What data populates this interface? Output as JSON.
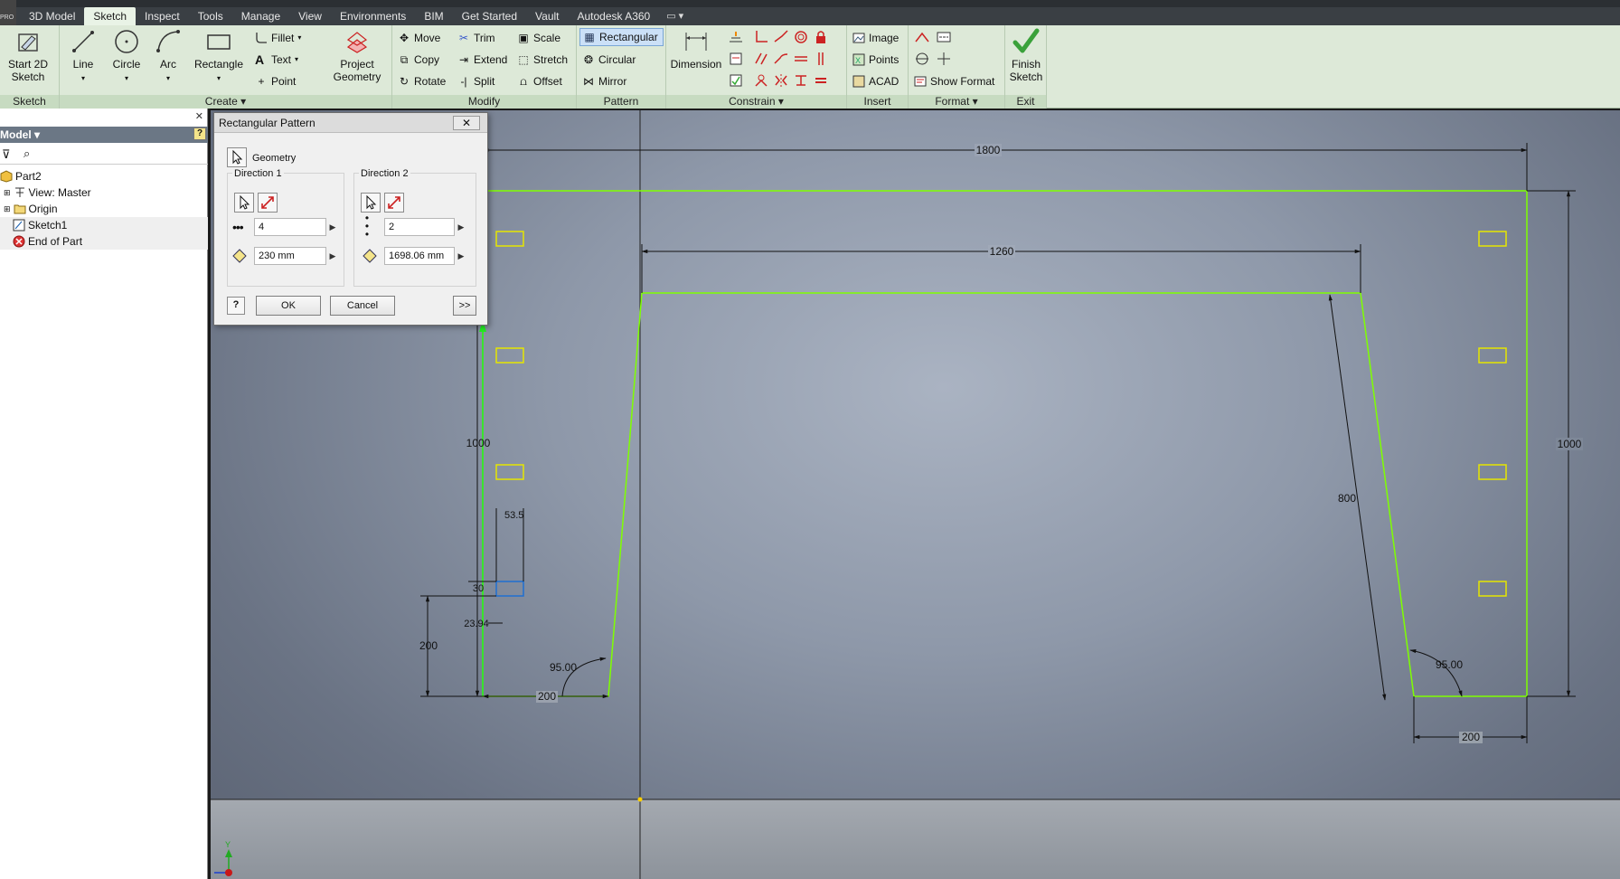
{
  "app": {
    "badge": "PRO"
  },
  "tabs": [
    {
      "label": "3D Model",
      "active": false
    },
    {
      "label": "Sketch",
      "active": true
    },
    {
      "label": "Inspect",
      "active": false
    },
    {
      "label": "Tools",
      "active": false
    },
    {
      "label": "Manage",
      "active": false
    },
    {
      "label": "View",
      "active": false
    },
    {
      "label": "Environments",
      "active": false
    },
    {
      "label": "BIM",
      "active": false
    },
    {
      "label": "Get Started",
      "active": false
    },
    {
      "label": "Vault",
      "active": false
    },
    {
      "label": "Autodesk A360",
      "active": false
    }
  ],
  "ribbon": {
    "sketch_panel": {
      "title": "Sketch",
      "start_sketch": "Start 2D Sketch"
    },
    "create_panel": {
      "title": "Create",
      "line": "Line",
      "circle": "Circle",
      "arc": "Arc",
      "rectangle": "Rectangle",
      "fillet": "Fillet",
      "text": "Text",
      "point": "Point",
      "project_geometry": "Project Geometry"
    },
    "modify_panel": {
      "title": "Modify",
      "move": "Move",
      "trim": "Trim",
      "scale": "Scale",
      "copy": "Copy",
      "extend": "Extend",
      "stretch": "Stretch",
      "rotate": "Rotate",
      "split": "Split",
      "offset": "Offset"
    },
    "pattern_panel": {
      "title": "Pattern",
      "rectangular": "Rectangular",
      "circular": "Circular",
      "mirror": "Mirror"
    },
    "constrain_panel": {
      "title": "Constrain",
      "dimension": "Dimension"
    },
    "insert_panel": {
      "title": "Insert",
      "image": "Image",
      "points": "Points",
      "acad": "ACAD"
    },
    "format_panel": {
      "title": "Format",
      "show_format": "Show Format"
    },
    "exit_panel": {
      "title": "Exit",
      "finish_sketch": "Finish Sketch"
    }
  },
  "browser": {
    "header": "Model",
    "items": [
      {
        "label": "Part2",
        "indent": 0,
        "icon": "part-icon"
      },
      {
        "label": "View: Master",
        "indent": 1,
        "icon": "view-icon"
      },
      {
        "label": "Origin",
        "indent": 1,
        "icon": "folder-icon"
      },
      {
        "label": "Sketch1",
        "indent": 1,
        "icon": "sketch-icon"
      },
      {
        "label": "End of Part",
        "indent": 1,
        "icon": "end-of-part-icon"
      }
    ]
  },
  "dialog": {
    "title": "Rectangular Pattern",
    "geometry_label": "Geometry",
    "direction1": {
      "label": "Direction 1",
      "count": "4",
      "spacing": "230 mm"
    },
    "direction2": {
      "label": "Direction 2",
      "count": "2",
      "spacing": "1698.06 mm"
    },
    "ok": "OK",
    "cancel": "Cancel",
    "more": ">>"
  },
  "dimensions": {
    "overall_width": "1800",
    "top_width": "1260",
    "left_height": "1000",
    "right_height": "1000",
    "slanted": "800",
    "offset_x": "53.5",
    "rect_height": "30",
    "gap": "23.94",
    "bottom_offset": "200",
    "left_angle": "95.00",
    "right_angle": "95.00",
    "left_base": "200",
    "right_base": "200"
  },
  "colors": {
    "sketch_line": "#7fff00",
    "pattern_rect": "#e6e600",
    "selected_rect": "#1f6fd1",
    "dimension": "#000000",
    "ribbon_bg": "#dde9d8",
    "tab_active": "#e9f3e6"
  }
}
